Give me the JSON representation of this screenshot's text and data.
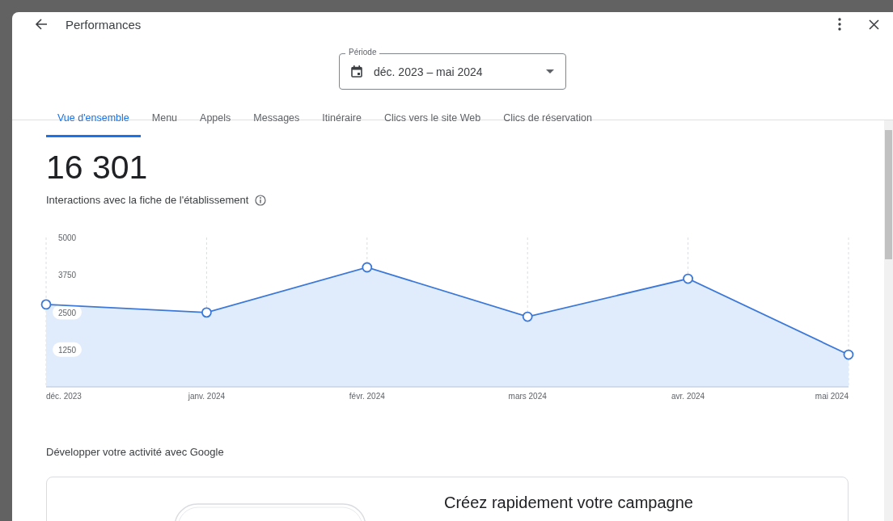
{
  "header": {
    "title": "Performances"
  },
  "period": {
    "label": "Période",
    "value": "déc. 2023 – mai 2024"
  },
  "tabs": [
    {
      "label": "Vue d'ensemble",
      "selected": true
    },
    {
      "label": "Menu",
      "selected": false
    },
    {
      "label": "Appels",
      "selected": false
    },
    {
      "label": "Messages",
      "selected": false
    },
    {
      "label": "Itinéraire",
      "selected": false
    },
    {
      "label": "Clics vers le site Web",
      "selected": false
    },
    {
      "label": "Clics de réservation",
      "selected": false
    }
  ],
  "summary": {
    "total": "16 301",
    "caption": "Interactions avec la fiche de l'établissement"
  },
  "chart_data": {
    "type": "area",
    "categories": [
      "déc. 2023",
      "janv. 2024",
      "févr. 2024",
      "mars 2024",
      "avr. 2024",
      "mai 2024"
    ],
    "series": [
      {
        "color": "#3b78d8",
        "values": [
          2760,
          2490,
          4000,
          2350,
          3620,
          1080
        ]
      }
    ],
    "ylim": [
      0,
      5000
    ],
    "grid": true,
    "yticks": [
      1250,
      2500,
      3750,
      5000
    ]
  },
  "promo": {
    "heading": "Développer votre activité avec Google",
    "card_title": "Créez rapidement votre campagne"
  }
}
